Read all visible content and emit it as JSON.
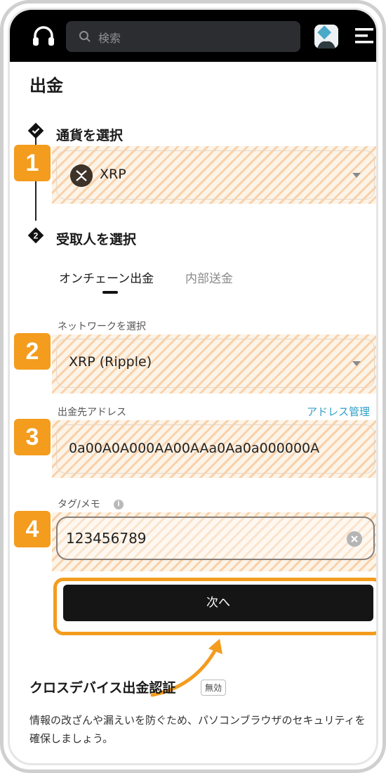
{
  "header": {
    "search_placeholder": "検索",
    "icons": [
      "headset-icon",
      "search-icon",
      "avatar",
      "menu-icon"
    ]
  },
  "page": {
    "title": "出金"
  },
  "steps": {
    "step1_title": "通貨を選択",
    "step2_number": "2",
    "step2_title": "受取人を選択"
  },
  "badges": [
    "1",
    "2",
    "3",
    "4"
  ],
  "currency": {
    "selected": "XRP"
  },
  "tabs": {
    "active": "オンチェーン出金",
    "inactive": "内部送金"
  },
  "network": {
    "label": "ネットワークを選択",
    "selected": "XRP (Ripple)"
  },
  "address": {
    "label": "出金先アドレス",
    "manage_link": "アドレス管理",
    "value": "0a00A0A000AA00AAa0Aa0a000000A"
  },
  "memo": {
    "label": "タグ/メモ",
    "info": "i",
    "value": "123456789"
  },
  "next_button": "次へ",
  "cross_device": {
    "title": "クロスデバイス出金認証",
    "badge": "無効",
    "description": "情報の改ざんや漏えいを防ぐため、パソコンブラウザのセキュリティを確保しましょう。"
  },
  "colors": {
    "accent": "#f39c1e",
    "link": "#2e9ec6",
    "topbar": "#000000",
    "button": "#151515"
  }
}
